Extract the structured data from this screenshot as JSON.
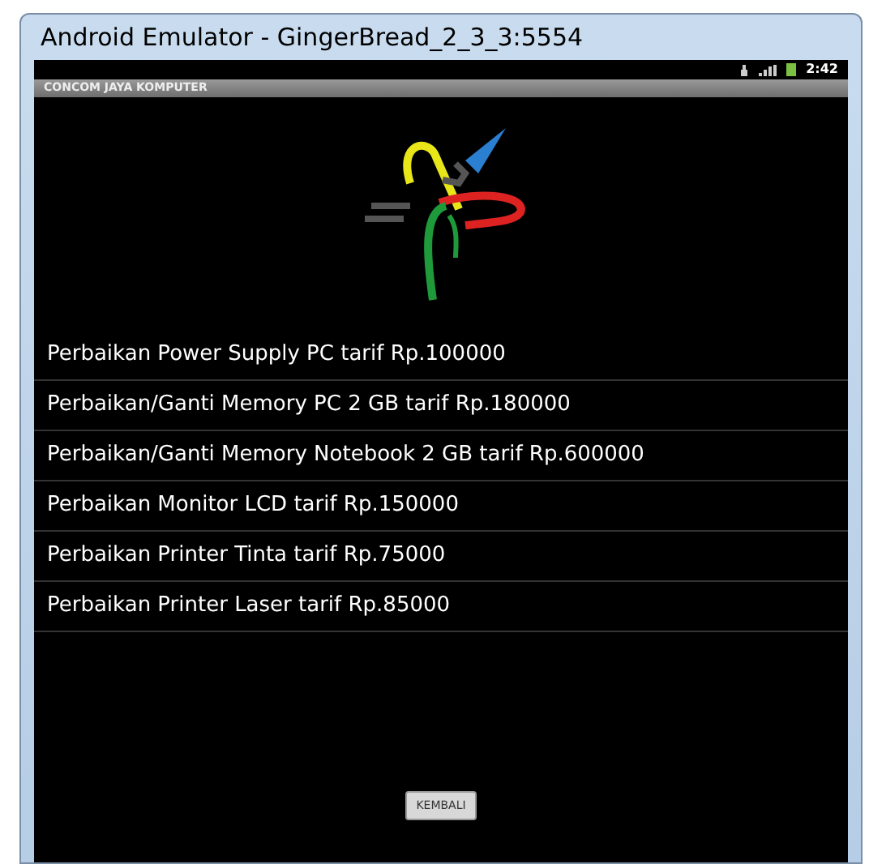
{
  "window": {
    "title": "Android Emulator - GingerBread_2_3_3:5554"
  },
  "status_bar": {
    "time": "2:42"
  },
  "app_title": "CONCOM JAYA KOMPUTER",
  "services": [
    "Perbaikan Power Supply PC tarif Rp.100000",
    "Perbaikan/Ganti Memory PC 2 GB tarif Rp.180000",
    "Perbaikan/Ganti Memory Notebook 2 GB tarif Rp.600000",
    "Perbaikan Monitor LCD tarif Rp.150000",
    "Perbaikan Printer Tinta tarif Rp.75000",
    "Perbaikan Printer Laser tarif Rp.85000"
  ],
  "button": "KEMBALI"
}
